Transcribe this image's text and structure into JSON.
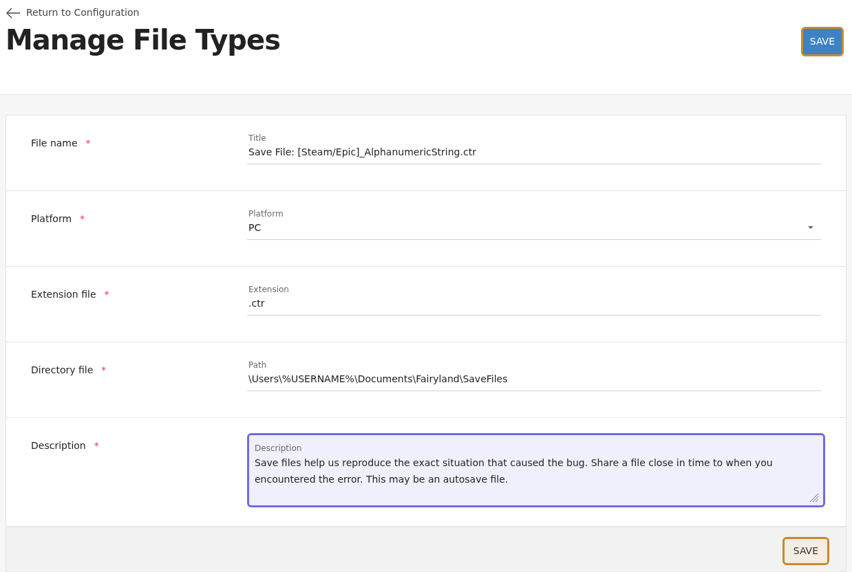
{
  "back_link": "Return to Configuration",
  "title": "Manage File Types",
  "header_button": "SAVE",
  "fields": [
    {
      "label": "File name",
      "required_mark": "*",
      "kind": "text",
      "field_label": "Title",
      "value": "Save File: [Steam/Epic]_AlphanumericString.ctr",
      "focused": false
    },
    {
      "label": "Platform",
      "required_mark": "*",
      "kind": "select",
      "field_label": "Platform",
      "value": "PC",
      "focused": false
    },
    {
      "label": "Extension file",
      "required_mark": "*",
      "kind": "text",
      "field_label": "Extension",
      "value": ".ctr",
      "focused": false
    },
    {
      "label": "Directory file",
      "required_mark": "*",
      "kind": "text",
      "field_label": "Path",
      "value": "\\Users\\%USERNAME%\\Documents\\Fairyland\\SaveFiles",
      "focused": false
    },
    {
      "label": "Description",
      "required_mark": "*",
      "kind": "textarea",
      "field_label": "Description",
      "value": "Save files help us reproduce the exact situation that caused the bug. Share a file close in time to when you encountered the error. This may be an autosave file.",
      "focused": true
    }
  ],
  "footer_button": "SAVE"
}
